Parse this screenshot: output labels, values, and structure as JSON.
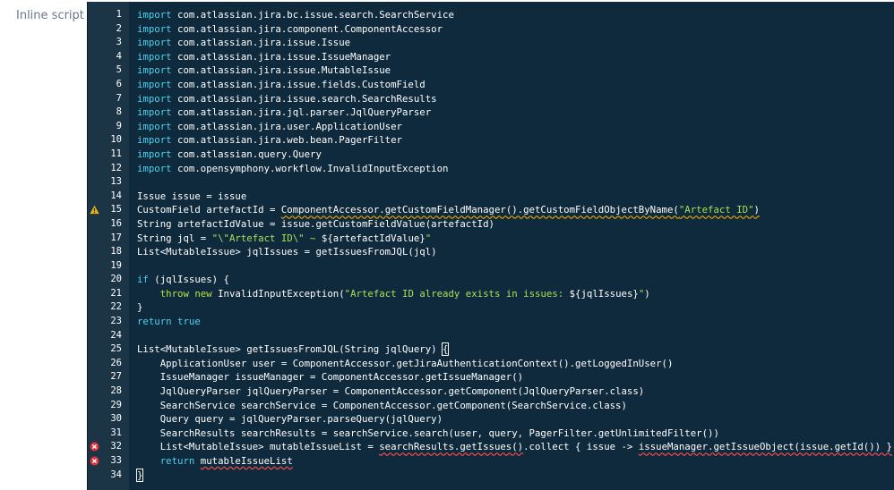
{
  "field": {
    "label": "Inline script"
  },
  "editor": {
    "colors": {
      "background": "#0f2a3c",
      "gutter": "#1b3446",
      "keyword": "#4fd2ee",
      "string": "#a8e05a",
      "warning": "#e6a800",
      "error": "#ff4d4d"
    },
    "lines": [
      {
        "n": "1",
        "segs": [
          {
            "c": "kw",
            "t": "import"
          },
          {
            "t": " com.atlassian.jira.bc.issue.search.SearchService"
          }
        ]
      },
      {
        "n": "2",
        "segs": [
          {
            "c": "kw",
            "t": "import"
          },
          {
            "t": " com.atlassian.jira.component.ComponentAccessor"
          }
        ]
      },
      {
        "n": "3",
        "segs": [
          {
            "c": "kw",
            "t": "import"
          },
          {
            "t": " com.atlassian.jira.issue.Issue"
          }
        ]
      },
      {
        "n": "4",
        "segs": [
          {
            "c": "kw",
            "t": "import"
          },
          {
            "t": " com.atlassian.jira.issue.IssueManager"
          }
        ]
      },
      {
        "n": "5",
        "segs": [
          {
            "c": "kw",
            "t": "import"
          },
          {
            "t": " com.atlassian.jira.issue.MutableIssue"
          }
        ]
      },
      {
        "n": "6",
        "segs": [
          {
            "c": "kw",
            "t": "import"
          },
          {
            "t": " com.atlassian.jira.issue.fields.CustomField"
          }
        ]
      },
      {
        "n": "7",
        "segs": [
          {
            "c": "kw",
            "t": "import"
          },
          {
            "t": " com.atlassian.jira.issue.search.SearchResults"
          }
        ]
      },
      {
        "n": "8",
        "segs": [
          {
            "c": "kw",
            "t": "import"
          },
          {
            "t": " com.atlassian.jira.jql.parser.JqlQueryParser"
          }
        ]
      },
      {
        "n": "9",
        "segs": [
          {
            "c": "kw",
            "t": "import"
          },
          {
            "t": " com.atlassian.jira.user.ApplicationUser"
          }
        ]
      },
      {
        "n": "10",
        "segs": [
          {
            "c": "kw",
            "t": "import"
          },
          {
            "t": " com.atlassian.jira.web.bean.PagerFilter"
          }
        ]
      },
      {
        "n": "11",
        "segs": [
          {
            "c": "kw",
            "t": "import"
          },
          {
            "t": " com.atlassian.query.Query"
          }
        ]
      },
      {
        "n": "12",
        "segs": [
          {
            "c": "kw",
            "t": "import"
          },
          {
            "t": " com.opensymphony.workflow.InvalidInputException"
          }
        ]
      },
      {
        "n": "13",
        "segs": []
      },
      {
        "n": "14",
        "segs": [
          {
            "t": "Issue issue = issue"
          }
        ]
      },
      {
        "n": "15",
        "icon": "warning",
        "segs": [
          {
            "t": "CustomField artefactId = "
          },
          {
            "c": "warn",
            "t": "ComponentAccessor.getCustomFieldManager().getCustomFieldObjectByName("
          },
          {
            "c": "str warn",
            "t": "\"Artefact ID\""
          },
          {
            "c": "warn",
            "t": ")"
          }
        ]
      },
      {
        "n": "16",
        "segs": [
          {
            "t": "String artefactIdValue = issue.getCustomFieldValue(artefactId)"
          }
        ]
      },
      {
        "n": "17",
        "segs": [
          {
            "t": "String jql = "
          },
          {
            "c": "str",
            "t": "\"\\\"Artefact ID\\\" ~ "
          },
          {
            "t": "${artefactIdValue}"
          },
          {
            "c": "str",
            "t": "\""
          }
        ]
      },
      {
        "n": "18",
        "segs": [
          {
            "t": "List<MutableIssue> jqlIssues = getIssuesFromJQL(jql)"
          }
        ]
      },
      {
        "n": "19",
        "segs": []
      },
      {
        "n": "20",
        "segs": [
          {
            "c": "kw",
            "t": "if"
          },
          {
            "t": " (jqlIssues) {"
          }
        ]
      },
      {
        "n": "21",
        "segs": [
          {
            "t": "    "
          },
          {
            "c": "kw2",
            "t": "throw new"
          },
          {
            "t": " InvalidInputException("
          },
          {
            "c": "str",
            "t": "\"Artefact ID already exists in issues: "
          },
          {
            "t": "${jqlIssues}"
          },
          {
            "c": "str",
            "t": "\""
          },
          {
            "t": ")"
          }
        ]
      },
      {
        "n": "22",
        "segs": [
          {
            "t": "}"
          }
        ]
      },
      {
        "n": "23",
        "segs": [
          {
            "c": "kw",
            "t": "return"
          },
          {
            "t": " "
          },
          {
            "c": "kw",
            "t": "true"
          }
        ]
      },
      {
        "n": "24",
        "segs": []
      },
      {
        "n": "25",
        "segs": [
          {
            "t": "List<MutableIssue> getIssuesFromJQL(String jqlQuery) "
          },
          {
            "c": "brace",
            "t": "{"
          }
        ]
      },
      {
        "n": "26",
        "segs": [
          {
            "t": "    ApplicationUser user = ComponentAccessor.getJiraAuthenticationContext().getLoggedInUser()"
          }
        ]
      },
      {
        "n": "27",
        "segs": [
          {
            "t": "    IssueManager issueManager = ComponentAccessor.getIssueManager()"
          }
        ]
      },
      {
        "n": "28",
        "segs": [
          {
            "t": "    JqlQueryParser jqlQueryParser = ComponentAccessor.getComponent(JqlQueryParser.class)"
          }
        ]
      },
      {
        "n": "29",
        "segs": [
          {
            "t": "    SearchService searchService = ComponentAccessor.getComponent(SearchService.class)"
          }
        ]
      },
      {
        "n": "30",
        "segs": [
          {
            "t": "    Query query = jqlQueryParser.parseQuery(jqlQuery)"
          }
        ]
      },
      {
        "n": "31",
        "segs": [
          {
            "t": "    SearchResults searchResults = searchService.search(user, query, PagerFilter.getUnlimitedFilter())"
          }
        ]
      },
      {
        "n": "32",
        "icon": "error",
        "segs": [
          {
            "t": "    List<MutableIssue> mutableIssueList = "
          },
          {
            "c": "err",
            "t": "searchResults.getIssues()"
          },
          {
            "t": ".collect { issue -> "
          },
          {
            "c": "err",
            "t": "issueManager.getIssueObject(issue.getId()) }"
          }
        ]
      },
      {
        "n": "33",
        "icon": "error",
        "segs": [
          {
            "t": "    "
          },
          {
            "c": "kw",
            "t": "return"
          },
          {
            "t": " "
          },
          {
            "c": "err",
            "t": "mutableIssueList"
          }
        ]
      },
      {
        "n": "34",
        "segs": [
          {
            "c": "brace",
            "t": "}"
          }
        ]
      }
    ]
  }
}
